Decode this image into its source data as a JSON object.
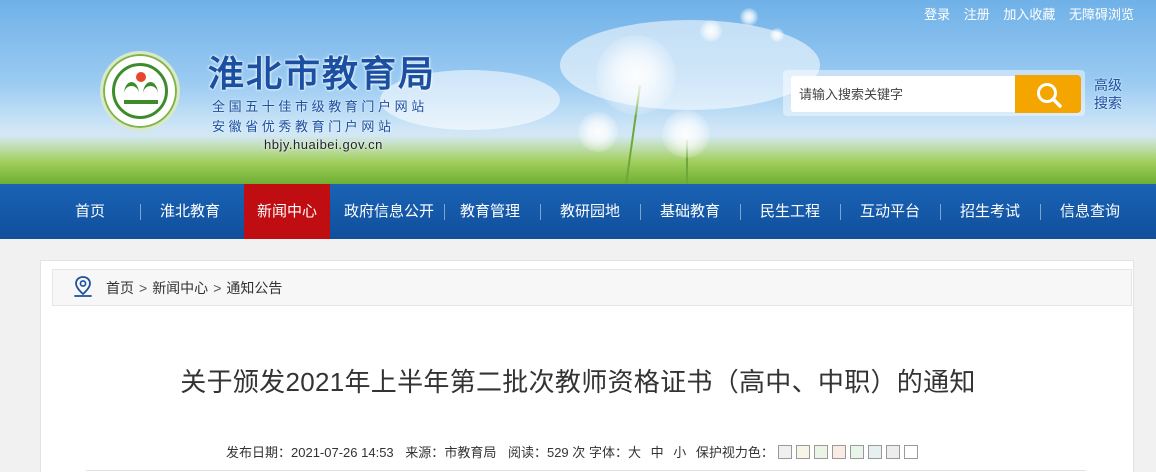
{
  "top_links": [
    "登录",
    "注册",
    "加入收藏",
    "无障碍浏览"
  ],
  "site": {
    "title": "淮北市教育局",
    "subtitle_1": "全国五十佳市级教育门户网站",
    "subtitle_2": "安徽省优秀教育门户网站",
    "domain": "hbjy.huaibei.gov.cn"
  },
  "search": {
    "placeholder": "请输入搜索关键字",
    "advanced_label_1": "高级",
    "advanced_label_2": "搜索"
  },
  "nav": {
    "items": [
      "首页",
      "淮北教育",
      "新闻中心",
      "政府信息公开",
      "教育管理",
      "教研园地",
      "基础教育",
      "民生工程",
      "互动平台",
      "招生考试",
      "信息查询"
    ],
    "active": "新闻中心"
  },
  "breadcrumb": [
    "首页",
    "新闻中心",
    "通知公告"
  ],
  "breadcrumb_separator": ">",
  "article": {
    "title": "关于颁发2021年上半年第二批次教师资格证书（高中、中职）的通知",
    "publish_label": "发布日期：",
    "publish_date": "2021-07-26 14:53",
    "source_label": "来源：",
    "source": "市教育局",
    "reads_label": "阅读：",
    "reads": "529",
    "reads_unit": "次",
    "font_label": "字体：",
    "font_sizes": [
      "大",
      "中",
      "小"
    ],
    "eye_care_label": "保护视力色：",
    "eye_care_colors": [
      "#f0f0f0",
      "#f7f5e6",
      "#ebf5e6",
      "#f9ebe6",
      "#e9f5e9",
      "#e6f0f0",
      "#ededed",
      "#ffffff"
    ]
  },
  "colors": {
    "nav_bg": "#135aa9",
    "nav_active": "#c00d12",
    "search_button": "#f5a500",
    "title_blue": "#1a4fa1"
  }
}
